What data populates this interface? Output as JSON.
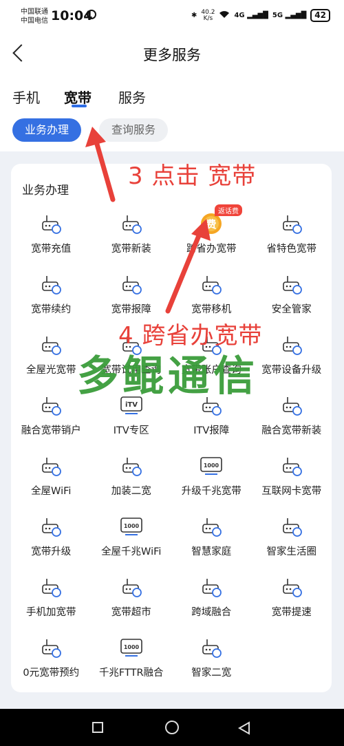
{
  "status": {
    "carrier1": "中国联通",
    "carrier2": "中国电信",
    "time": "10:04",
    "net_speed_value": "40.2",
    "net_speed_unit": "K/s",
    "sig1": "4G",
    "sig2": "5G",
    "battery": "42"
  },
  "header": {
    "title": "更多服务",
    "tabs": [
      {
        "label": "手机",
        "active": false
      },
      {
        "label": "宽带",
        "active": true
      },
      {
        "label": "服务",
        "active": false
      }
    ],
    "sub_tabs": [
      {
        "label": "业务办理",
        "active": true
      },
      {
        "label": "查询服务",
        "active": false
      }
    ]
  },
  "section": {
    "title": "业务办理",
    "items": [
      {
        "label": "宽带充值",
        "icon": "broadband-recharge-icon"
      },
      {
        "label": "宽带新装",
        "icon": "broadband-install-icon"
      },
      {
        "label": "跨省办宽带",
        "icon": "cross-province-fee-icon",
        "badge": "返话费",
        "icon_text": "费"
      },
      {
        "label": "省特色宽带",
        "icon": "province-broadband-icon"
      },
      {
        "label": "宽带续约",
        "icon": "broadband-renew-icon"
      },
      {
        "label": "宽带报障",
        "icon": "broadband-report-icon"
      },
      {
        "label": "宽带移机",
        "icon": "broadband-move-icon"
      },
      {
        "label": "安全管家",
        "icon": "security-shield-icon"
      },
      {
        "label": "全屋光宽带",
        "icon": "home-fiber-icon"
      },
      {
        "label": "宽带试用查询",
        "icon": "broadband-trial-query-icon"
      },
      {
        "label": "宽带账户查询",
        "icon": "broadband-account-query-icon"
      },
      {
        "label": "宽带设备升级",
        "icon": "device-upgrade-icon"
      },
      {
        "label": "融合宽带销户",
        "icon": "bundle-cancel-icon"
      },
      {
        "label": "ITV专区",
        "icon": "itv-icon",
        "icon_text": "iTV"
      },
      {
        "label": "ITV报障",
        "icon": "itv-report-icon"
      },
      {
        "label": "融合宽带新装",
        "icon": "bundle-install-icon"
      },
      {
        "label": "全屋WiFi",
        "icon": "home-wifi-icon"
      },
      {
        "label": "加装二宽",
        "icon": "second-broadband-icon"
      },
      {
        "label": "升级千兆宽带",
        "icon": "gigabit-upgrade-icon",
        "icon_text": "1000"
      },
      {
        "label": "互联网卡宽带",
        "icon": "internet-card-icon"
      },
      {
        "label": "宽带升级",
        "icon": "broadband-upgrade-icon"
      },
      {
        "label": "全屋千兆WiFi",
        "icon": "gigabit-wifi-icon",
        "icon_text": "1000"
      },
      {
        "label": "智慧家庭",
        "icon": "smart-home-icon"
      },
      {
        "label": "智家生活圈",
        "icon": "smart-life-icon"
      },
      {
        "label": "手机加宽带",
        "icon": "phone-broadband-icon"
      },
      {
        "label": "宽带超市",
        "icon": "broadband-market-icon"
      },
      {
        "label": "跨域融合",
        "icon": "cross-domain-icon"
      },
      {
        "label": "宽带提速",
        "icon": "speedup-rocket-icon"
      },
      {
        "label": "0元宽带预约",
        "icon": "free-reserve-icon"
      },
      {
        "label": "千兆FTTR融合",
        "icon": "fttr-icon",
        "icon_text": "1000"
      },
      {
        "label": "智家二宽",
        "icon": "smart-second-icon"
      }
    ]
  },
  "annotations": {
    "step3": "3 点击 宽带",
    "step4": "4 跨省办宽带",
    "watermark": "多鲲通信",
    "arrow_color": "#e8413a"
  },
  "colors": {
    "accent": "#3570e2",
    "icon": "#3570e2"
  }
}
